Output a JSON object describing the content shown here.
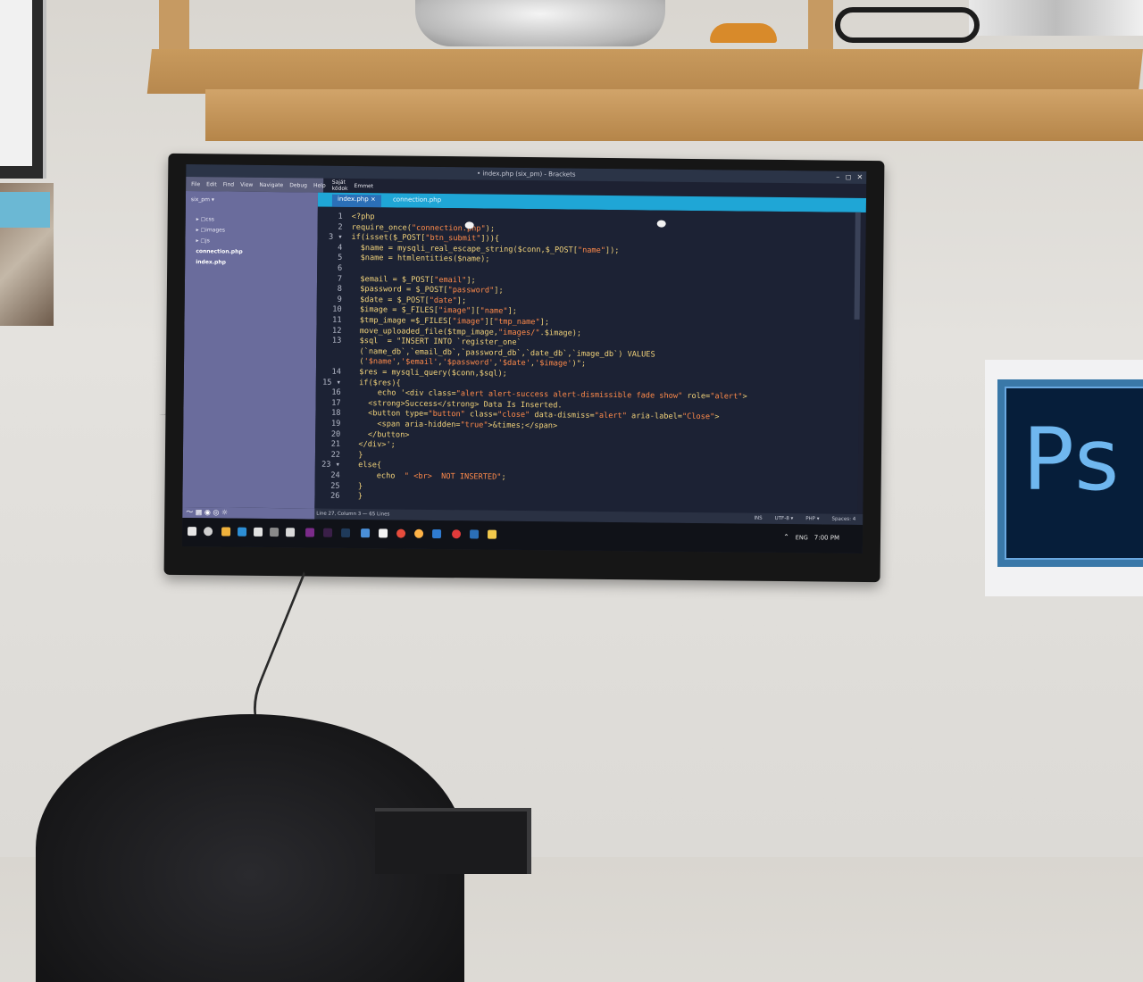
{
  "window": {
    "title": "• index.php (six_pm) - Brackets",
    "controls": [
      "–",
      "◻",
      "✕"
    ]
  },
  "menu": [
    "File",
    "Edit",
    "Find",
    "View",
    "Navigate",
    "Debug",
    "Help",
    "Saját kódok",
    "Emmet"
  ],
  "sidebar": {
    "project": "six_pm ▾",
    "tree": [
      {
        "label": "▸ ▢css",
        "kind": "folder"
      },
      {
        "label": "▸ ▢images",
        "kind": "folder"
      },
      {
        "label": "▸ ▢js",
        "kind": "folder"
      },
      {
        "label": "connection.php",
        "kind": "file"
      },
      {
        "label": "index.php",
        "kind": "file"
      }
    ],
    "bottom_icons": "〜 ▦ ◉ ◎ ☼"
  },
  "tabs": [
    {
      "label": "index.php ×"
    },
    {
      "label": "connection.php"
    }
  ],
  "code_lines": [
    {
      "n": "1",
      "t": "<?php"
    },
    {
      "n": "2",
      "t": "require_once(\"connection.php\");"
    },
    {
      "n": "3 ▾",
      "t": "if(isset($_POST[\"btn_submit\"])){"
    },
    {
      "n": "4",
      "t": "  $name = mysqli_real_escape_string($conn,$_POST[\"name\"]);"
    },
    {
      "n": "5",
      "t": "  $name = htmlentities($name);"
    },
    {
      "n": "6",
      "t": ""
    },
    {
      "n": "7",
      "t": "  $email = $_POST[\"email\"];"
    },
    {
      "n": "8",
      "t": "  $password = $_POST[\"password\"];"
    },
    {
      "n": "9",
      "t": "  $date = $_POST[\"date\"];"
    },
    {
      "n": "10",
      "t": "  $image = $_FILES[\"image\"][\"name\"];"
    },
    {
      "n": "11",
      "t": "  $tmp_image =$_FILES[\"image\"][\"tmp_name\"];"
    },
    {
      "n": "12",
      "t": "  move_uploaded_file($tmp_image,\"images/\".$image);"
    },
    {
      "n": "13",
      "t": "  $sql  = \"INSERT INTO `register_one`"
    },
    {
      "n": "",
      "t": "  (`name_db`,`email_db`,`password_db`,`date_db`,`image_db`) VALUES"
    },
    {
      "n": "",
      "t": "  ('$name','$email','$password','$date','$image')\";"
    },
    {
      "n": "14",
      "t": "  $res = mysqli_query($conn,$sql);"
    },
    {
      "n": "15 ▾",
      "t": "  if($res){"
    },
    {
      "n": "16",
      "t": "      echo '<div class=\"alert alert-success alert-dismissible fade show\" role=\"alert\">"
    },
    {
      "n": "17",
      "t": "    <strong>Success</strong> Data Is Inserted."
    },
    {
      "n": "18",
      "t": "    <button type=\"button\" class=\"close\" data-dismiss=\"alert\" aria-label=\"Close\">"
    },
    {
      "n": "19",
      "t": "      <span aria-hidden=\"true\">&times;</span>"
    },
    {
      "n": "20",
      "t": "    </button>"
    },
    {
      "n": "21",
      "t": "  </div>';"
    },
    {
      "n": "22",
      "t": "  }"
    },
    {
      "n": "23 ▾",
      "t": "  else{"
    },
    {
      "n": "24",
      "t": "      echo  \" <br>  NOT INSERTED\";"
    },
    {
      "n": "25",
      "t": "  }"
    },
    {
      "n": "26",
      "t": "  }"
    }
  ],
  "status": {
    "position": "Line 27, Column 3 — 65 Lines",
    "mode": "INS",
    "encoding": "UTF-8 ▾",
    "language": "PHP ▾",
    "spaces": "Spaces: 4"
  },
  "taskbar": {
    "lang": "ENG",
    "time": "7:00 PM",
    "caret": "⌃"
  },
  "poster": {
    "text": "Ps"
  },
  "colors": {
    "editor_bg": "#1c2234",
    "sidebar_bg": "#6a6c9c",
    "tabbar_bg": "#1fa6d6",
    "code_default": "#f1d27a",
    "code_string": "#ff8a4a",
    "ps_blue": "#6fb7ef"
  }
}
